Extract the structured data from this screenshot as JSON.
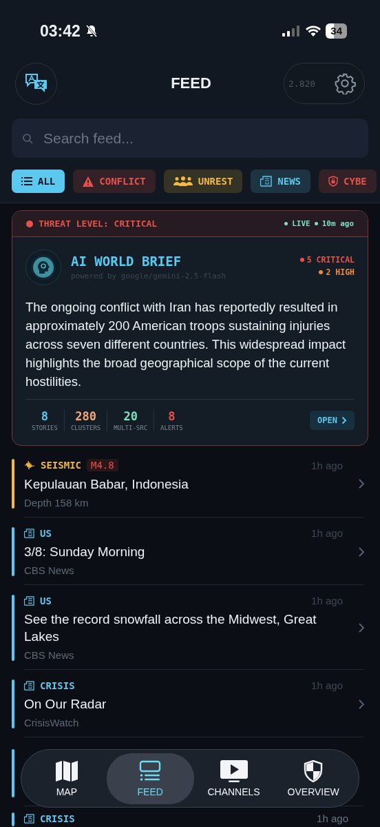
{
  "status_bar": {
    "time": "03:42",
    "battery": "34"
  },
  "header": {
    "title": "FEED",
    "counter": "2.820"
  },
  "search": {
    "placeholder": "Search feed..."
  },
  "filters": [
    {
      "label": "ALL",
      "kind": "all",
      "selected": true,
      "color": "#5bc8f0"
    },
    {
      "label": "CONFLICT",
      "kind": "conflict",
      "selected": false,
      "color": "#e5534b"
    },
    {
      "label": "UNREST",
      "kind": "unrest",
      "selected": false,
      "color": "#f4b942"
    },
    {
      "label": "NEWS",
      "kind": "news",
      "selected": false,
      "color": "#5bc8f0"
    },
    {
      "label": "CYBE",
      "kind": "cyber",
      "selected": false,
      "color": "#e5534b"
    }
  ],
  "brief": {
    "threat": "THREAT LEVEL: CRITICAL",
    "live": "LIVE",
    "age": "10m ago",
    "title": "AI WORLD BRIEF",
    "powered": "powered by google/gemini-2.5-flash",
    "severities": [
      {
        "label": "5 CRITICAL",
        "color": "#e5534b"
      },
      {
        "label": "2 HIGH",
        "color": "#f08a3c"
      }
    ],
    "summary": "The ongoing conflict with Iran has reportedly resulted in approximately 200 American troops sustaining injuries across seven different countries. This widespread impact highlights the broad geographical scope of the current hostilities.",
    "stats": [
      {
        "value": "8",
        "label": "STORIES",
        "color": "#5bc8f0"
      },
      {
        "value": "280",
        "label": "CLUSTERS",
        "color": "#f0a878"
      },
      {
        "value": "20",
        "label": "MULTI-SRC",
        "color": "#7ee0c0"
      },
      {
        "value": "8",
        "label": "ALERTS",
        "color": "#e5534b"
      }
    ],
    "open": "OPEN"
  },
  "items": [
    {
      "kind": "seismic",
      "category": "SEISMIC",
      "badge": "M4.8",
      "time": "1h ago",
      "title": "Kepulauan Babar, Indonesia",
      "source": "Depth 158 km",
      "color": "#f4b942"
    },
    {
      "kind": "news",
      "category": "US",
      "time": "1h ago",
      "title": "3/8: Sunday Morning",
      "source": "CBS News",
      "color": "#5bc8f0"
    },
    {
      "kind": "news",
      "category": "US",
      "time": "1h ago",
      "title": "See the record snowfall across the Midwest, Great Lakes",
      "source": "CBS News",
      "color": "#5bc8f0"
    },
    {
      "kind": "news",
      "category": "CRISIS",
      "time": "1h ago",
      "title": "On Our Radar",
      "source": "CrisisWatch",
      "color": "#5bc8f0"
    },
    {
      "kind": "hidden",
      "color": "#5bc8f0"
    },
    {
      "kind": "news",
      "category": "CRISIS",
      "time": "1h ago",
      "color": "#5bc8f0"
    }
  ],
  "nav": [
    {
      "label": "MAP",
      "kind": "map",
      "selected": false
    },
    {
      "label": "FEED",
      "kind": "feed",
      "selected": true
    },
    {
      "label": "CHANNELS",
      "kind": "channels",
      "selected": false
    },
    {
      "label": "OVERVIEW",
      "kind": "overview",
      "selected": false
    }
  ]
}
